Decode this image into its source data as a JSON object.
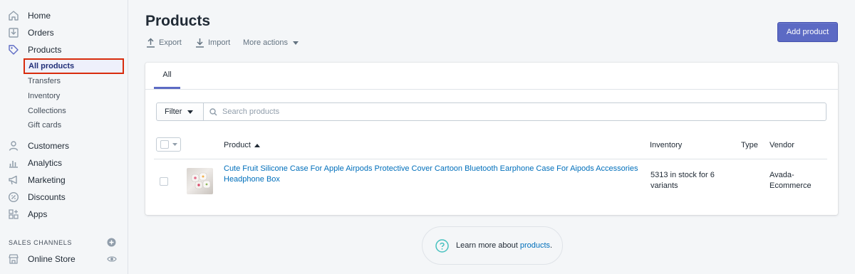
{
  "sidebar": {
    "items": [
      {
        "label": "Home",
        "icon": "home-icon"
      },
      {
        "label": "Orders",
        "icon": "orders-icon"
      },
      {
        "label": "Products",
        "icon": "tag-icon"
      },
      {
        "label": "Customers",
        "icon": "user-icon"
      },
      {
        "label": "Analytics",
        "icon": "bar-chart-icon"
      },
      {
        "label": "Marketing",
        "icon": "megaphone-icon"
      },
      {
        "label": "Discounts",
        "icon": "percent-icon"
      },
      {
        "label": "Apps",
        "icon": "apps-grid-icon"
      }
    ],
    "product_subitems": [
      {
        "label": "All products",
        "active": true
      },
      {
        "label": "Transfers"
      },
      {
        "label": "Inventory"
      },
      {
        "label": "Collections"
      },
      {
        "label": "Gift cards"
      }
    ],
    "sales_channels": {
      "title": "SALES CHANNELS",
      "online_store": "Online Store"
    }
  },
  "page": {
    "title": "Products",
    "actions": {
      "export": "Export",
      "import": "Import",
      "more": "More actions"
    },
    "add_button": "Add product"
  },
  "tabs": [
    {
      "label": "All",
      "active": true
    }
  ],
  "filter": {
    "button": "Filter",
    "search_placeholder": "Search products"
  },
  "table": {
    "columns": {
      "product": "Product",
      "inventory": "Inventory",
      "type": "Type",
      "vendor": "Vendor"
    },
    "rows": [
      {
        "product": "Cute Fruit Silicone Case For Apple Airpods Protective Cover Cartoon Bluetooth Earphone Case For Aipods Accessories Headphone Box",
        "inventory": "5313 in stock for 6 variants",
        "type": "",
        "vendor": "Avada-Ecommerce"
      }
    ]
  },
  "learn_more": {
    "text": "Learn more about",
    "link": "products",
    "suffix": "."
  },
  "colors": {
    "accent": "#5c6ac4",
    "link": "#006fbb",
    "highlight_border": "#d82c0d"
  }
}
